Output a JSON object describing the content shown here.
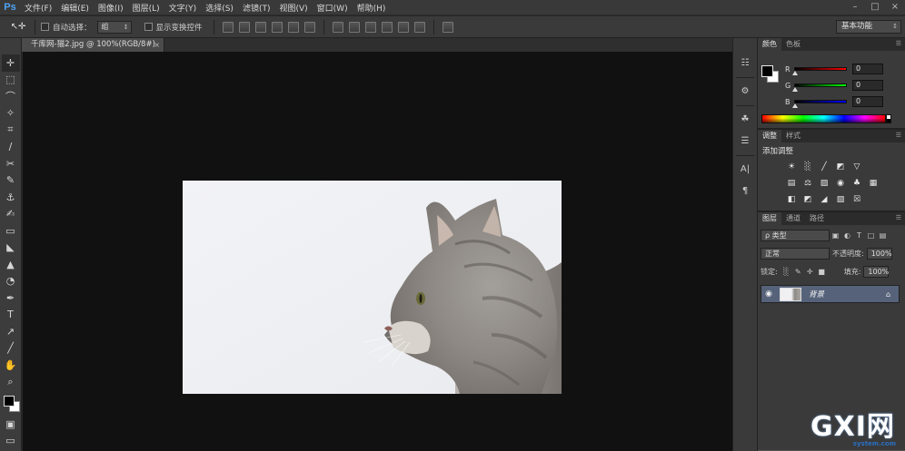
{
  "app": {
    "logo": "Ps"
  },
  "menu": [
    "文件(F)",
    "编辑(E)",
    "图像(I)",
    "图层(L)",
    "文字(Y)",
    "选择(S)",
    "滤镜(T)",
    "视图(V)",
    "窗口(W)",
    "帮助(H)"
  ],
  "window_controls": {
    "minimize": "–",
    "maximize": "□",
    "close": "×"
  },
  "options": {
    "auto_select_label": "自动选择：",
    "auto_select_value": "组",
    "show_transform_label": "显示变换控件",
    "workspace": "基本功能"
  },
  "document": {
    "tab_title": "千库网-猫2.jpg @ 100%(RGB/8#)",
    "close": "×"
  },
  "tools": [
    "move",
    "marquee",
    "lasso",
    "magic-wand",
    "crop",
    "eyedropper",
    "healing",
    "brush",
    "stamp",
    "history-brush",
    "eraser",
    "paint-bucket",
    "blur",
    "dodge",
    "pen",
    "type",
    "path-select",
    "line",
    "hand",
    "zoom"
  ],
  "colors": {
    "foreground": "#000000",
    "background": "#ffffff",
    "accent": "#4ea4f5",
    "layer_selected": "#56627a"
  },
  "color_panel": {
    "tabs": [
      "颜色",
      "色板"
    ],
    "active_tab": 0,
    "channels": [
      {
        "label": "R",
        "value": "0",
        "gradient": "linear-gradient(to right,#000,#ff0000)"
      },
      {
        "label": "G",
        "value": "0",
        "gradient": "linear-gradient(to right,#000,#00ff00)"
      },
      {
        "label": "B",
        "value": "0",
        "gradient": "linear-gradient(to right,#000,#0000ff)"
      }
    ]
  },
  "adjust_panel": {
    "tabs": [
      "调整",
      "样式"
    ],
    "active_tab": 0,
    "title": "添加调整"
  },
  "layers_panel": {
    "tabs": [
      "图层",
      "通道",
      "路径"
    ],
    "active_tab": 0,
    "filter_type": "ρ 类型",
    "blend_mode": "正常",
    "opacity_label": "不透明度:",
    "opacity_value": "100%",
    "lock_label": "锁定:",
    "fill_label": "填充:",
    "fill_value": "100%",
    "layers": [
      {
        "name": "背景",
        "visible": true,
        "locked": true
      }
    ]
  },
  "watermark": {
    "text": "GXI网",
    "sub": "system.com"
  }
}
